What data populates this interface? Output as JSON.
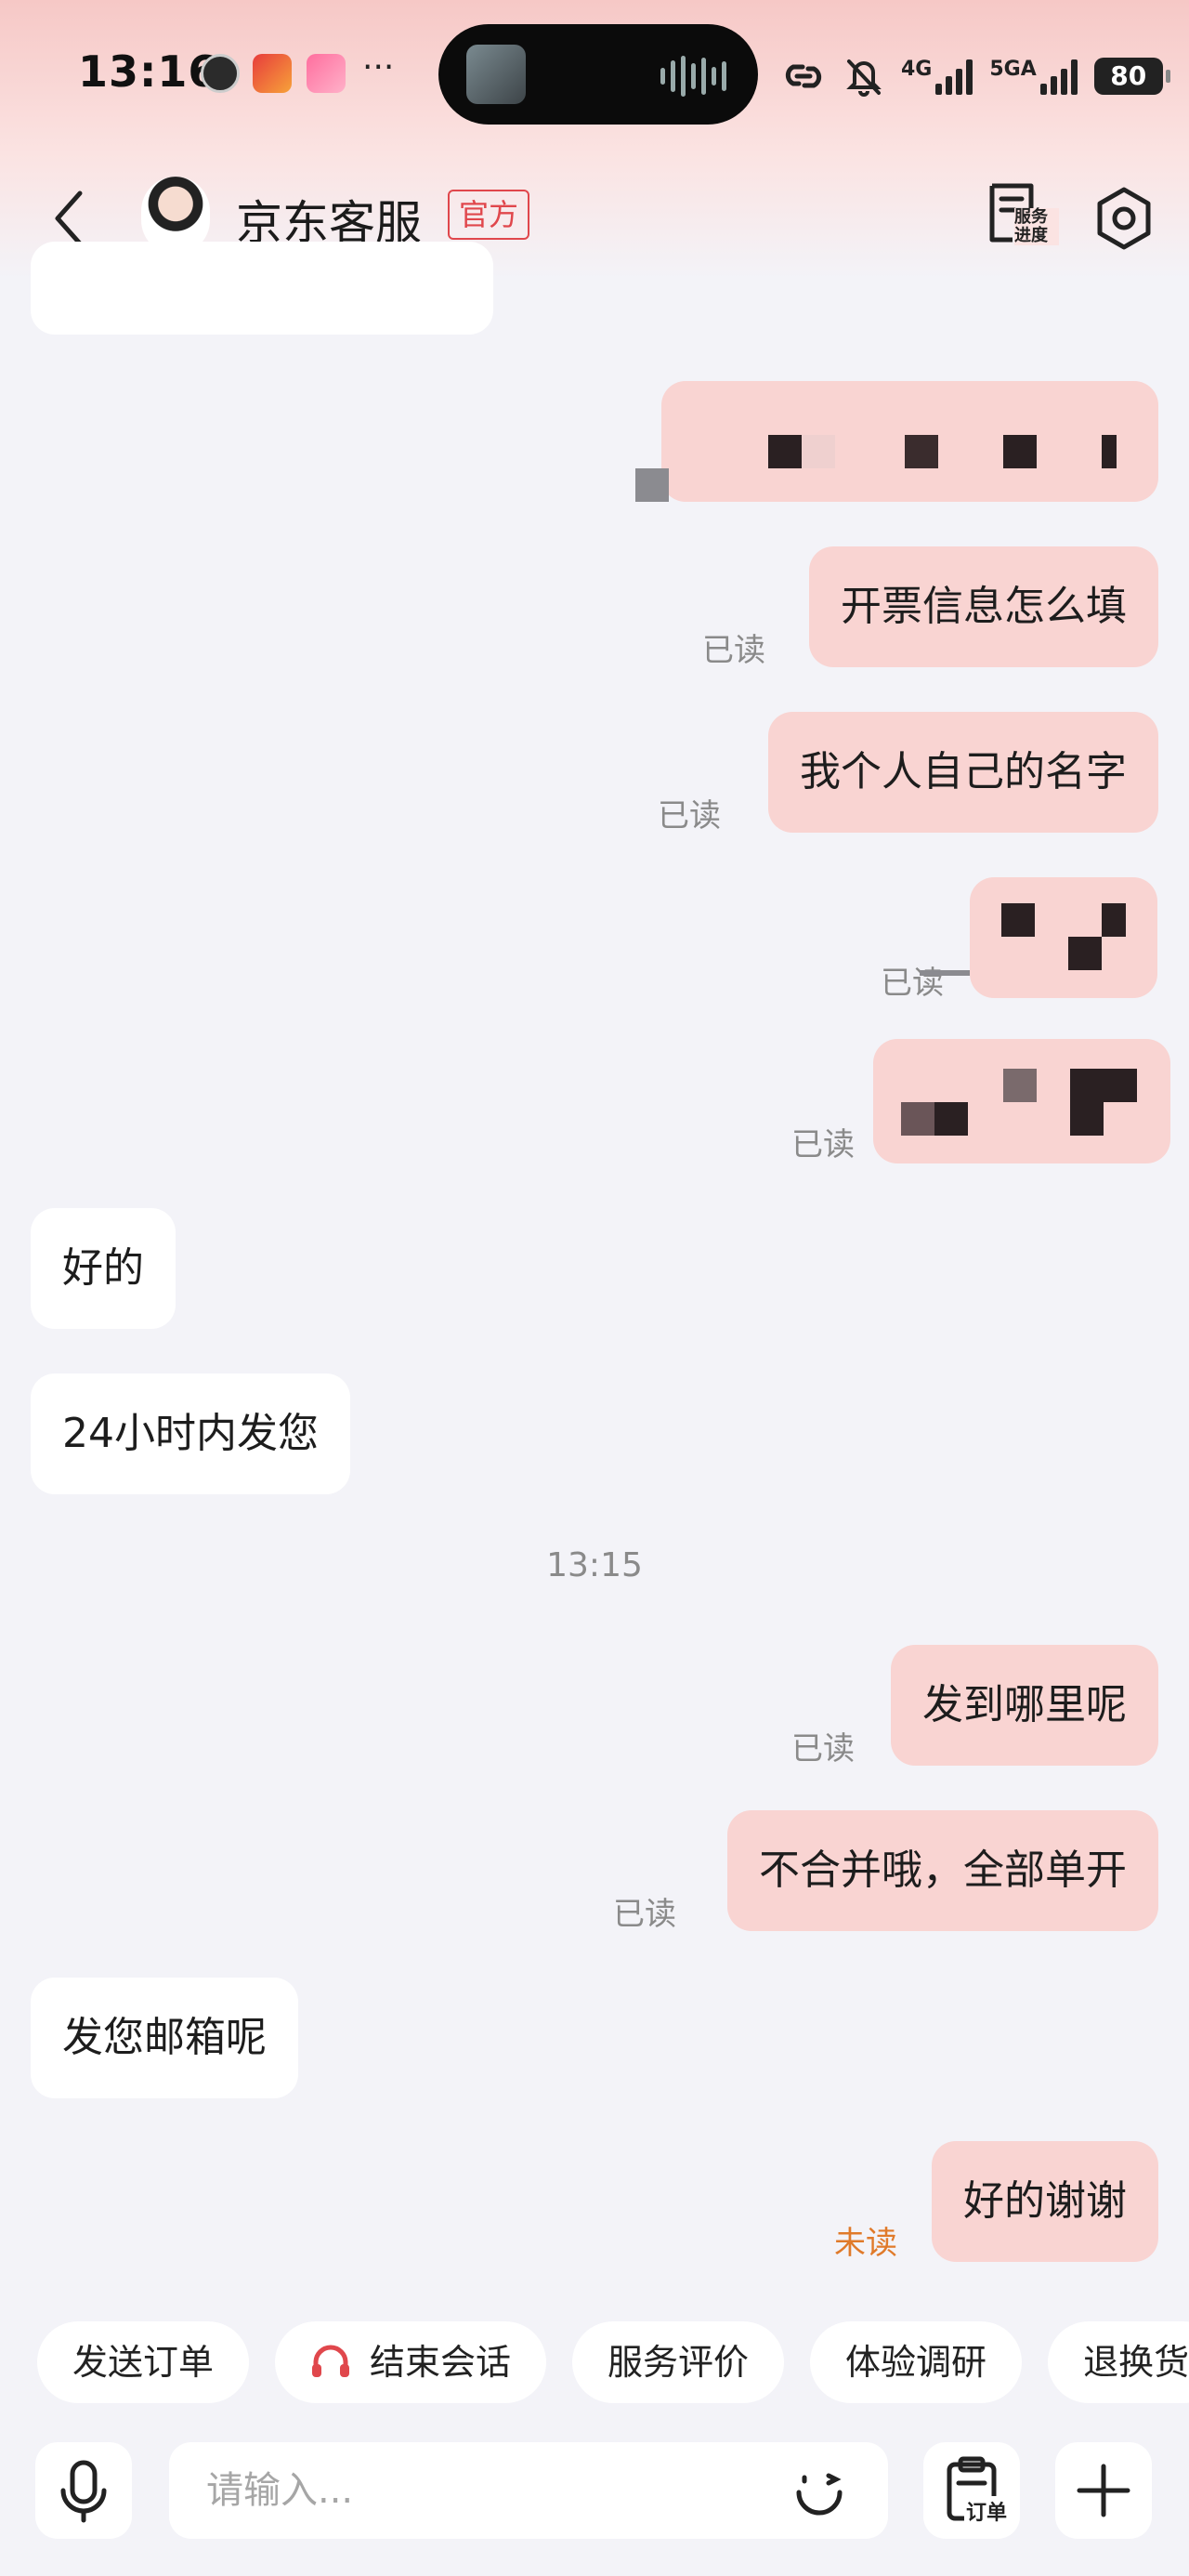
{
  "status_bar": {
    "time": "13:16",
    "more": "···",
    "net1": "4G",
    "net2": "5GA",
    "battery": "80"
  },
  "header": {
    "title": "京东客服",
    "badge": "官方",
    "progress_label": "服务\n进度"
  },
  "messages": {
    "m_invoice": "开票信息怎么填",
    "m_invoice_status": "已读",
    "m_name": "我个人自己的名字",
    "m_name_status": "已读",
    "m_img1_status": "已读",
    "m_img2_status": "已读",
    "r_ok": "好的",
    "r_24h": "24小时内发您",
    "time_divider": "13:15",
    "m_where": "发到哪里呢",
    "m_where_status": "已读",
    "m_separate": "不合并哦，全部单开",
    "m_separate_status": "已读",
    "r_email": "发您邮箱呢",
    "m_thanks": "好的谢谢",
    "m_thanks_status": "未读"
  },
  "quick_actions": [
    "发送订单",
    "结束会话",
    "服务评价",
    "体验调研",
    "退换货"
  ],
  "input": {
    "placeholder": "请输入...",
    "order_label": "订单"
  },
  "colors": {
    "accent": "#e0474c",
    "bubble_out": "#f9d4d2",
    "bubble_in": "#ffffff",
    "background": "#f3f3f8",
    "unread": "#e07a2a"
  }
}
